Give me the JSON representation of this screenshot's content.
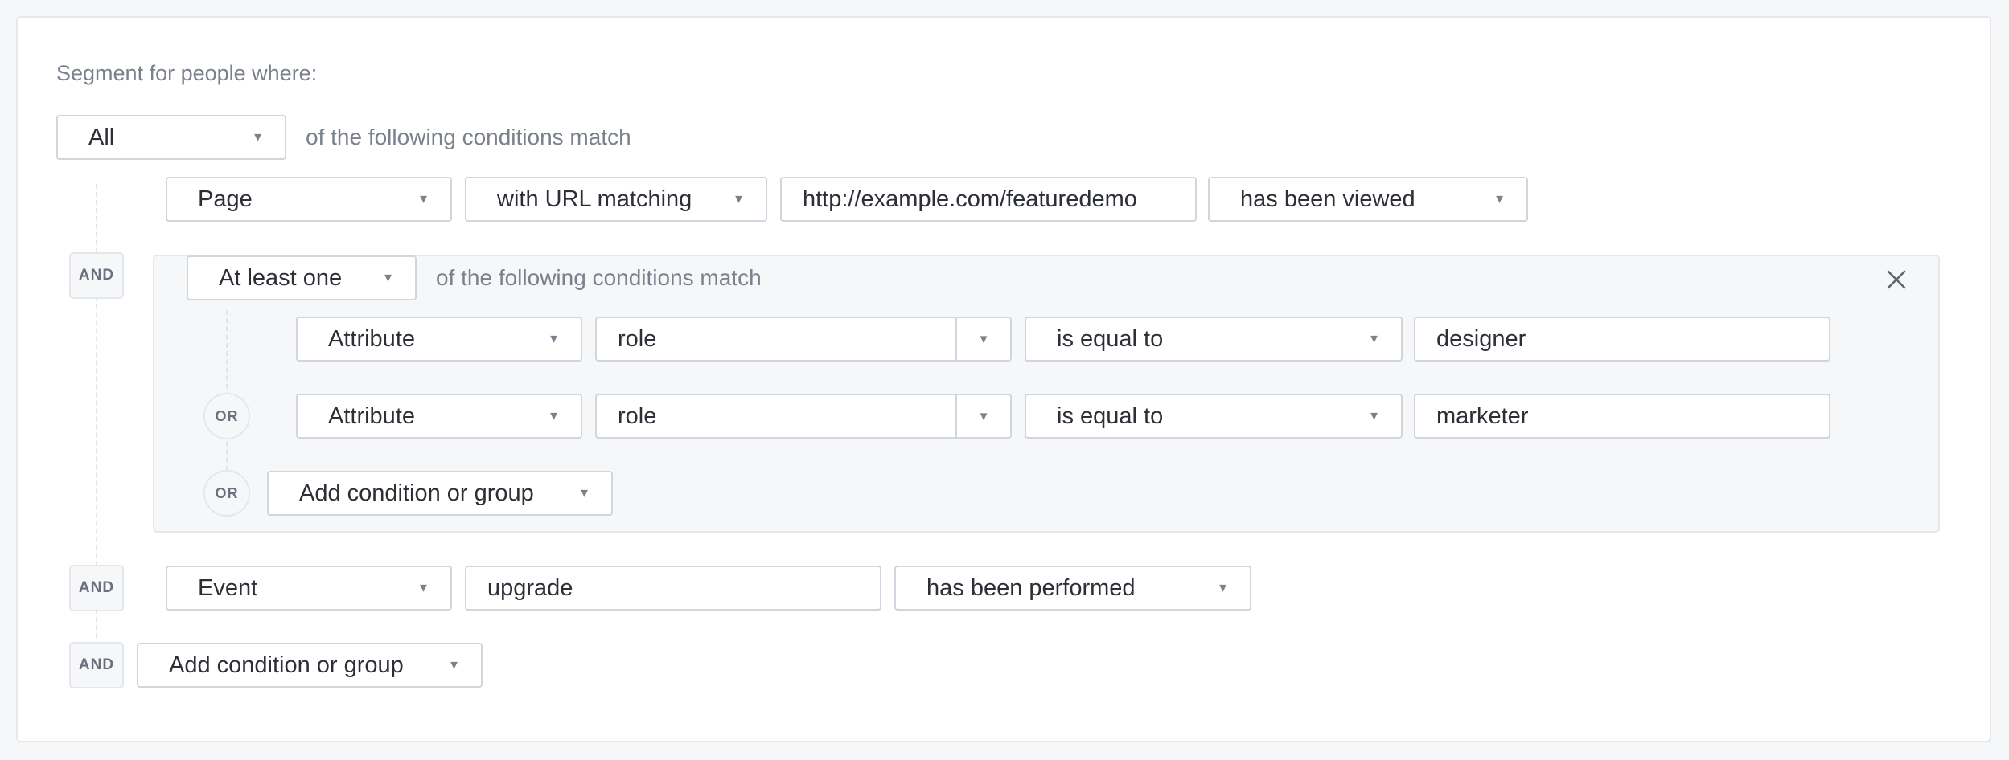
{
  "segment": {
    "title": "Segment for people where:",
    "match_mode": "All",
    "match_suffix": "of the following conditions match"
  },
  "conditions": {
    "page": {
      "type": "Page",
      "operator": "with URL matching",
      "url": "http://example.com/featuredemo",
      "state": "has been viewed"
    },
    "group": {
      "connector": "AND",
      "match_mode": "At least one",
      "match_suffix": "of the following conditions match",
      "rows": [
        {
          "type": "Attribute",
          "attribute": "role",
          "operator": "is equal to",
          "value": "designer"
        },
        {
          "connector": "OR",
          "type": "Attribute",
          "attribute": "role",
          "operator": "is equal to",
          "value": "marketer"
        }
      ],
      "add": {
        "connector": "OR",
        "label": "Add condition or group"
      }
    },
    "event": {
      "connector": "AND",
      "type": "Event",
      "name": "upgrade",
      "state": "has been performed"
    },
    "add": {
      "connector": "AND",
      "label": "Add condition or group"
    }
  },
  "icons": {
    "dropdown": "caret-down-icon",
    "close": "close-icon"
  },
  "colors": {
    "border": "#d2d6dc",
    "muted_text": "#7a818d",
    "group_bg": "#f6f7f9"
  }
}
